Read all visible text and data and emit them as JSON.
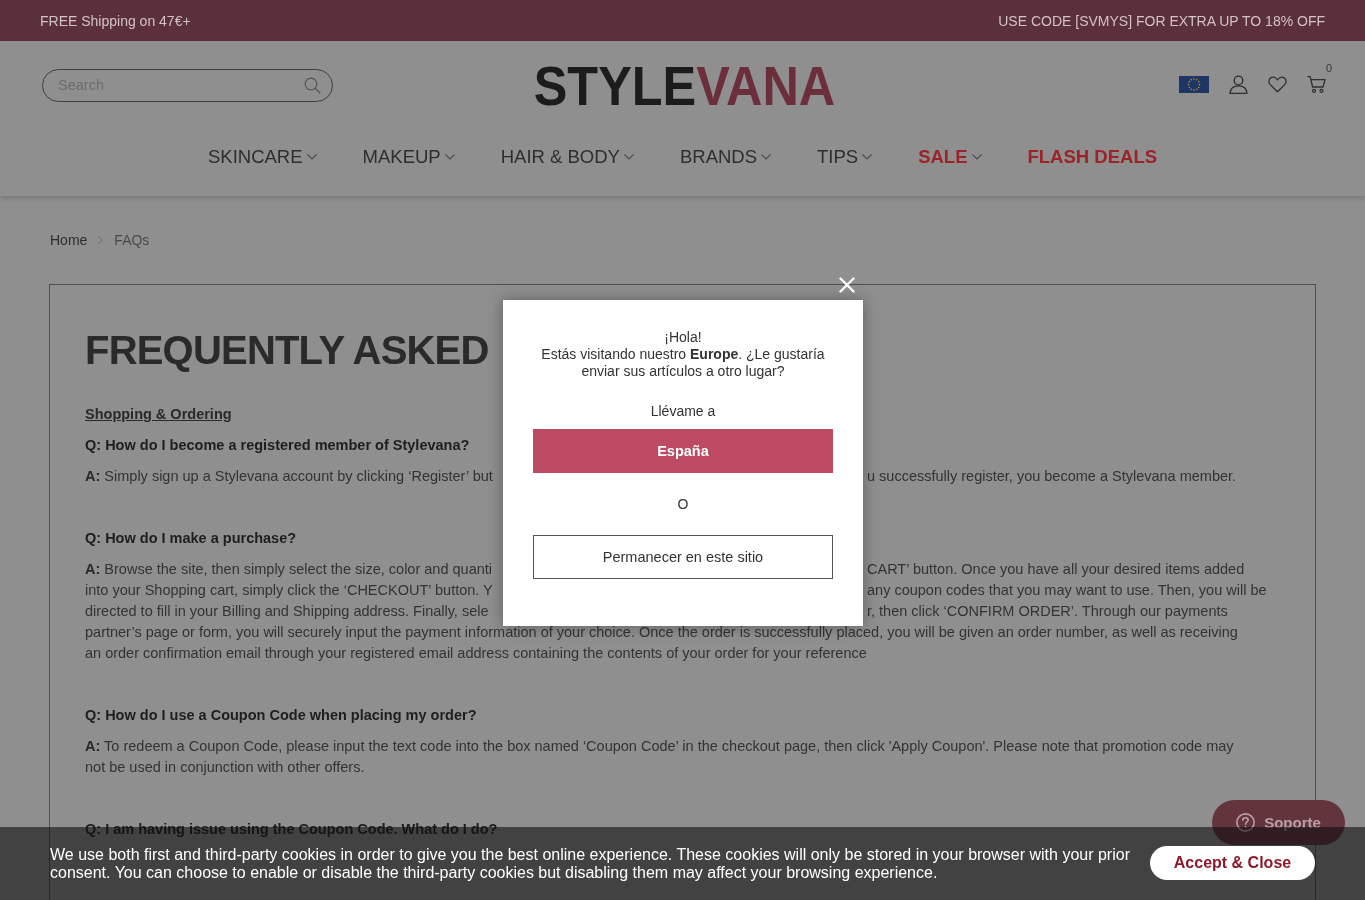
{
  "promo_bar": {
    "left": "FREE Shipping on 47€+",
    "right": "USE CODE [SVMYS] FOR EXTRA UP TO 18% OFF"
  },
  "header": {
    "search": {
      "placeholder": "Search"
    },
    "logo": {
      "dark": "STYLE",
      "accent": "VANA"
    },
    "cart_count": "0"
  },
  "nav": [
    {
      "label": "SKINCARE",
      "dropdown": true,
      "highlight": false
    },
    {
      "label": "MAKEUP",
      "dropdown": true,
      "highlight": false
    },
    {
      "label": "HAIR & BODY",
      "dropdown": true,
      "highlight": false
    },
    {
      "label": "BRANDS",
      "dropdown": true,
      "highlight": false
    },
    {
      "label": "TIPS",
      "dropdown": true,
      "highlight": false
    },
    {
      "label": "SALE",
      "dropdown": true,
      "highlight": true
    },
    {
      "label": "FLASH DEALS",
      "dropdown": false,
      "highlight": true
    }
  ],
  "breadcrumb": [
    "Home",
    "FAQs"
  ],
  "faq": {
    "title": "FREQUENTLY ASKED",
    "section": "Shopping & Ordering",
    "items": [
      {
        "question": "Q: How do I become a registered member of Stylevana?",
        "lines": [
          {
            "kind": "split",
            "left": "**A:** Simply sign up a Stylevana account by clicking ‘Register’ but",
            "right": "u successfully register, you become a Stylevana member."
          }
        ]
      },
      {
        "question": "Q: How do I make a purchase?",
        "lines": [
          {
            "kind": "split",
            "left": "**A:** Browse the site, then simply select the size, color and quanti",
            "right": "CART’ button. Once you have all your desired items added"
          },
          {
            "kind": "split",
            "left": "into your Shopping cart, simply click the ‘CHECKOUT’ button. Y",
            "right": "any coupon codes that you may want to use. Then, you will be"
          },
          {
            "kind": "split",
            "left": "directed to fill in your Billing and Shipping address. Finally, sele",
            "right": "r, then click ‘CONFIRM ORDER’. Through our payments"
          },
          {
            "kind": "full",
            "text": "partner’s page or form, you will securely input the payment information of your choice. Once the order is successfully placed, you will be given an order number, as well as receiving"
          },
          {
            "kind": "full",
            "text": "an order confirmation email through your registered email address containing the contents of your order for your reference"
          }
        ]
      },
      {
        "question": "Q: How do I use a Coupon Code when placing my order?",
        "lines": [
          {
            "kind": "full",
            "text": "**A:** To redeem a Coupon Code, please input the text code into the box named ‘Coupon Code’ in the checkout page, then click 'Apply Coupon'. Please note that promotion code may"
          },
          {
            "kind": "full",
            "text": "not be used in conjunction with other offers."
          }
        ]
      },
      {
        "question": "Q: I am having issue using the Coupon Code. What do I do?"
      }
    ]
  },
  "support_button": {
    "label": "Soporte"
  },
  "modal": {
    "greeting": "¡Hola!",
    "message": "Estás visitando nuestro **Europe**. ¿Le gustaría enviar sus artículos a otro lugar?",
    "prompt": "Llévame a",
    "primary": "España",
    "separator": "O",
    "secondary": "Permanecer en este sitio"
  },
  "cookie_banner": {
    "text": "We use both first and third-party cookies in order to give you the best online experience. These cookies will only be stored in your browser with your prior consent. You can choose to enable or disable the third-party cookies but disabling them may affect your browsing experience.",
    "button": "Accept & Close"
  }
}
